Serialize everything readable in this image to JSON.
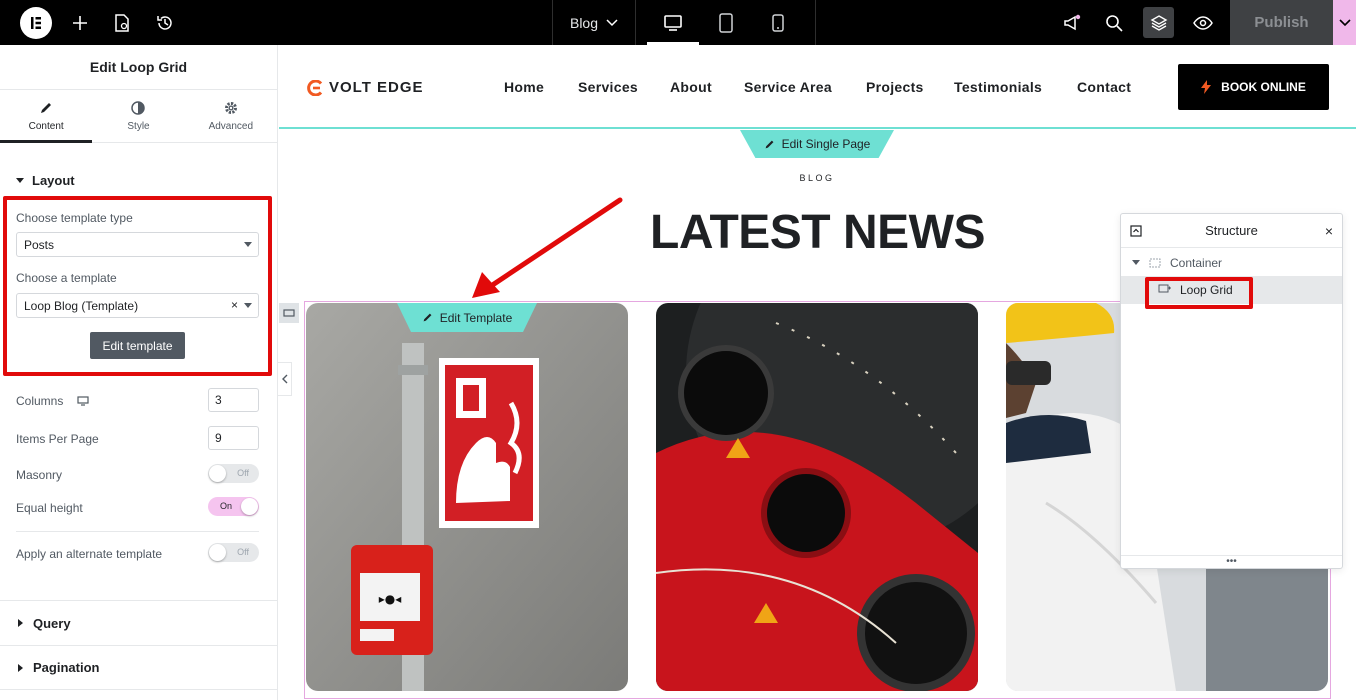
{
  "topbar": {
    "page_selector": "Blog",
    "publish_label": "Publish"
  },
  "panel": {
    "title": "Edit Loop Grid",
    "tabs": [
      {
        "label": "Content",
        "icon": "pencil-icon"
      },
      {
        "label": "Style",
        "icon": "half-circle-icon"
      },
      {
        "label": "Advanced",
        "icon": "gear-icon"
      }
    ],
    "layout_heading": "Layout",
    "template_type_label": "Choose template type",
    "template_type_value": "Posts",
    "template_label": "Choose a template",
    "template_value": "Loop Blog (Template)",
    "edit_template_button": "Edit template",
    "columns_label": "Columns",
    "columns_value": "3",
    "items_per_page_label": "Items Per Page",
    "items_per_page_value": "9",
    "masonry_label": "Masonry",
    "masonry_state": "Off",
    "equal_height_label": "Equal height",
    "equal_height_state": "On",
    "alternate_label": "Apply an alternate template",
    "alternate_state": "Off",
    "query_heading": "Query",
    "pagination_heading": "Pagination"
  },
  "site": {
    "brand": "VOLT EDGE",
    "nav": [
      "Home",
      "Services",
      "About",
      "Service Area",
      "Projects",
      "Testimonials",
      "Contact"
    ],
    "book_button": "BOOK ONLINE",
    "edit_single_page": "Edit Single Page",
    "kicker": "BLOG",
    "heading": "LATEST NEWS",
    "edit_template": "Edit Template"
  },
  "structure": {
    "title": "Structure",
    "items": [
      {
        "label": "Container",
        "selected": false
      },
      {
        "label": "Loop Grid",
        "selected": true
      }
    ]
  },
  "colors": {
    "accent_teal": "#6ee0d3",
    "highlight_red": "#e10a0a",
    "brand_orange": "#f15a22",
    "loop_outline": "#e5a7e0"
  }
}
